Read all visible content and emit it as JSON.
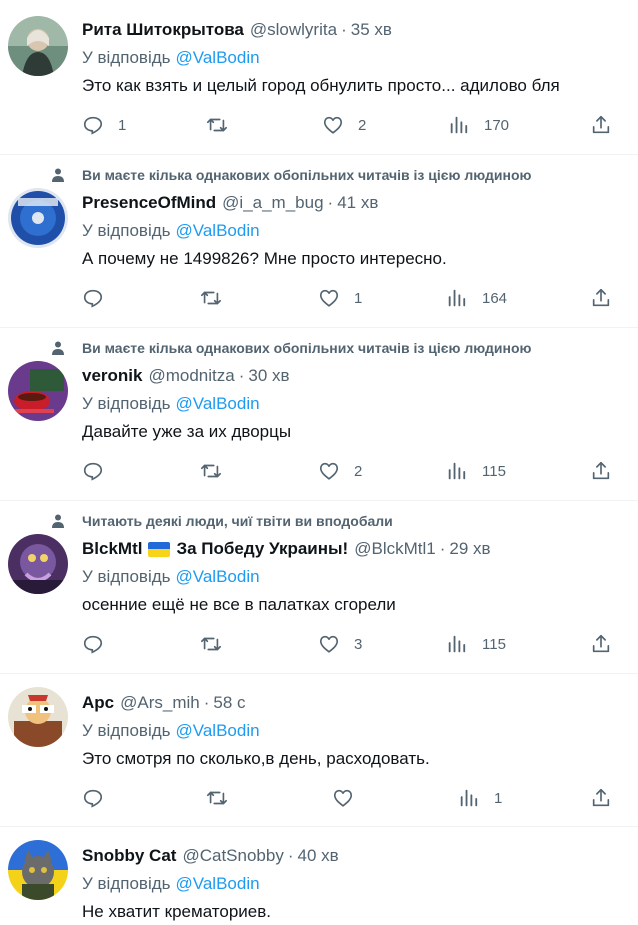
{
  "reply_prefix": "У відповідь",
  "tweets": [
    {
      "name": "Рита Шитокрытова",
      "handle": "@slowlyrita",
      "time": "35 хв",
      "mention": "@ValBodin",
      "text": "Это как взять и целый город обнулить просто... адилово бля",
      "replies": "1",
      "retweets": "",
      "likes": "2",
      "views": "170"
    },
    {
      "social": "Ви маєте кілька однакових обопільних читачів із цією людиною",
      "name": "PresenceOfMind",
      "handle": "@i_a_m_bug",
      "time": "41 хв",
      "mention": "@ValBodin",
      "text": "А почему не 1499826? Мне просто интересно.",
      "replies": "",
      "retweets": "",
      "likes": "1",
      "views": "164"
    },
    {
      "social": "Ви маєте кілька однакових обопільних читачів із цією людиною",
      "name": "veronik",
      "handle": "@modnitza",
      "time": "30 хв",
      "mention": "@ValBodin",
      "text": "Давайте уже за их дворцы",
      "replies": "",
      "retweets": "",
      "likes": "2",
      "views": "115"
    },
    {
      "social": "Читають деякі люди, чиї твіти ви вподобали",
      "name": "BlckMtl",
      "name_suffix": "За Победу Украины!",
      "handle": "@BlckMtl1",
      "time": "29 хв",
      "mention": "@ValBodin",
      "text": "осенние ещё не все в палатках сгорели",
      "replies": "",
      "retweets": "",
      "likes": "3",
      "views": "115"
    },
    {
      "name": "Apc",
      "handle": "@Ars_mih",
      "time": "58 с",
      "mention": "@ValBodin",
      "text": "Это смотря по сколько,в день, расходовать.",
      "replies": "",
      "retweets": "",
      "likes": "",
      "views": "1"
    },
    {
      "name": "Snobby Cat",
      "handle": "@CatSnobby",
      "time": "40 хв",
      "mention": "@ValBodin",
      "text": "Не хватит крематориев."
    }
  ],
  "colors": {
    "accent": "#1d9bf0",
    "secondary_text": "#536471",
    "border": "#eff3f4"
  },
  "icons": [
    "reply-icon",
    "retweet-icon",
    "like-icon",
    "views-icon",
    "share-icon",
    "person-icon"
  ]
}
